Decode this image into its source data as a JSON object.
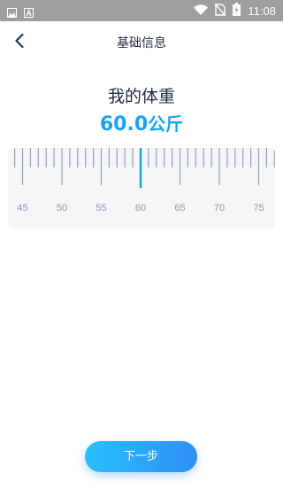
{
  "status_bar": {
    "time": "11:08",
    "left_icons": [
      "image-icon",
      "a-icon"
    ],
    "right_icons": [
      "wifi-icon",
      "no-sim-icon",
      "battery-charging-icon"
    ]
  },
  "header": {
    "title": "基础信息",
    "back_icon": "chevron-left-icon"
  },
  "heading": "我的体重",
  "weight": {
    "value": "60.0",
    "unit": "公斤"
  },
  "ruler": {
    "min": 45,
    "max": 75,
    "selected": 60.0,
    "major_step": 5,
    "labels": [
      "45",
      "50",
      "55",
      "60",
      "65",
      "70",
      "75"
    ],
    "accent_color": "#1aa3f0",
    "tick_color": "#9aa4ae"
  },
  "next_button": {
    "label": "下一步"
  }
}
